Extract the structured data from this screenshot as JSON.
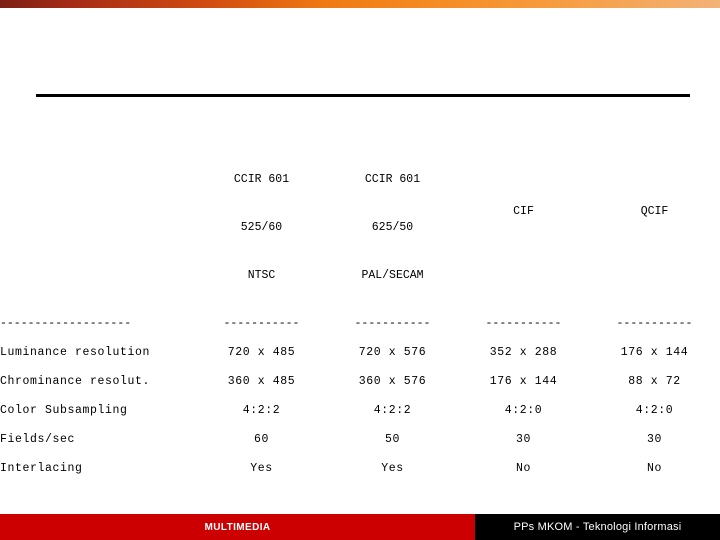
{
  "slide": {
    "top_bar": {
      "gradient_start": "#7d1f16",
      "gradient_mid": "#ef7912",
      "gradient_end": "#f3b277"
    },
    "rule_color": "#000000"
  },
  "table": {
    "label_column_header": "",
    "separator_label": "-------------------",
    "separator_data": "-----------",
    "columns": [
      {
        "line1": "CCIR 601",
        "line2": "525/60",
        "line3": "NTSC"
      },
      {
        "line1": "CCIR 601",
        "line2": "625/50",
        "line3": "PAL/SECAM"
      },
      {
        "line1": "CIF",
        "line2": "",
        "line3": ""
      },
      {
        "line1": "QCIF",
        "line2": "",
        "line3": ""
      }
    ],
    "rows": [
      {
        "label": "Luminance resolution",
        "values": [
          "720 x 485",
          "720 x 576",
          "352 x 288",
          "176 x 144"
        ]
      },
      {
        "label": "Chrominance resolut.",
        "values": [
          "360 x 485",
          "360 x 576",
          "176 x 144",
          "88 x 72"
        ]
      },
      {
        "label": "Color Subsampling",
        "values": [
          "4:2:2",
          "4:2:2",
          "4:2:0",
          "4:2:0"
        ]
      },
      {
        "label": "Fields/sec",
        "values": [
          "60",
          "50",
          "30",
          "30"
        ]
      },
      {
        "label": "Interlacing",
        "values": [
          "Yes",
          "Yes",
          "No",
          "No"
        ]
      }
    ]
  },
  "footer": {
    "left_label": "MULTIMEDIA",
    "right_label": "PPs MKOM - Teknologi Informasi",
    "left_bg": "#cc0000",
    "right_bg": "#000000"
  }
}
